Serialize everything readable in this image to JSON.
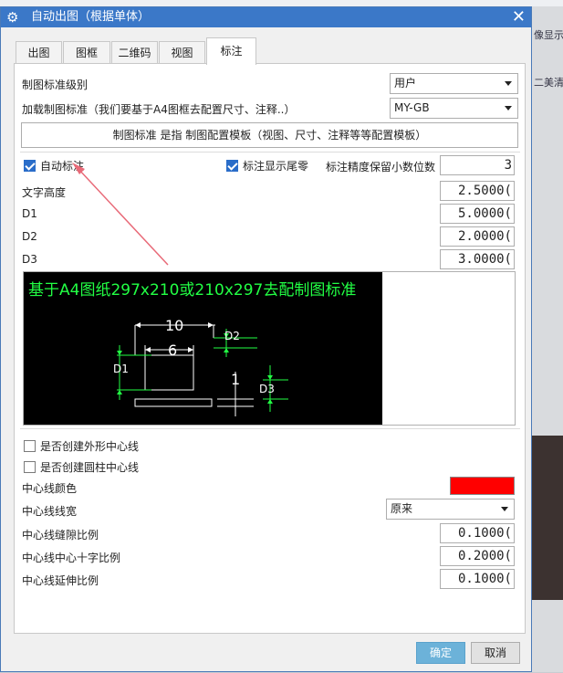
{
  "background_app": {
    "right_fragments": [
      "像显示",
      "二美清"
    ]
  },
  "dialog": {
    "title": "自动出图（根据单体）",
    "icon": "gear-icon",
    "close_glyph": "✕"
  },
  "tabs": [
    "出图",
    "图框",
    "二维码",
    "视图",
    "标注"
  ],
  "active_tab": "标注",
  "standard": {
    "level_label": "制图标准级别",
    "level_value": "用户",
    "load_label": "加载制图标准（我们要基于A4图框去配置尺寸、注释..）",
    "load_value": "MY-GB",
    "template_button": "制图标准 是指 制图配置模板（视图、尺寸、注释等等配置模板）"
  },
  "annotation": {
    "auto_label": "自动标注",
    "auto_checked": true,
    "trailing_zero_label": "标注显示尾零",
    "trailing_zero_checked": true,
    "precision_label": "标注精度保留小数位数",
    "precision_value": "3",
    "text_height_label": "文字高度",
    "text_height_value": "2.5000(",
    "d1_label": "D1",
    "d1_value": "5.0000(",
    "d2_label": "D2",
    "d2_value": "2.0000(",
    "d3_label": "D3",
    "d3_value": "3.0000("
  },
  "preview": {
    "headline": "基于A4图纸297x210或210x297去配制图标准",
    "dim_10": "10",
    "dim_6": "6",
    "dim_1": "1",
    "tag_d1": "D1",
    "tag_d2": "D2",
    "tag_d3": "D3"
  },
  "centerline": {
    "outline_label": "是否创建外形中心线",
    "outline_checked": false,
    "cylinder_label": "是否创建圆柱中心线",
    "cylinder_checked": false,
    "color_label": "中心线颜色",
    "color_value": "#ff0000",
    "width_label": "中心线线宽",
    "width_value": "原来",
    "gap_label": "中心线缝隙比例",
    "gap_value": "0.1000(",
    "cross_label": "中心线中心十字比例",
    "cross_value": "0.2000(",
    "extend_label": "中心线延伸比例",
    "extend_value": "0.1000("
  },
  "buttons": {
    "ok": "确定",
    "cancel": "取消"
  },
  "colors": {
    "title_bar": "#3b78c8",
    "accent": "#2a6dc9",
    "preview_text": "#22ff44",
    "annotation_arrow": "#e86a78",
    "ok_button": "#6cb2d9"
  }
}
